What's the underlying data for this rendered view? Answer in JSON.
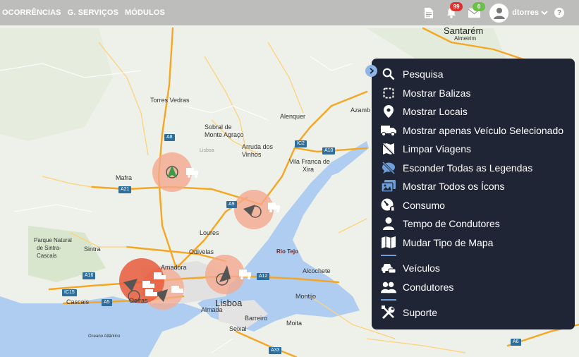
{
  "nav": {
    "items": [
      "OCORRÊNCIAS",
      "G. SERVIÇOS",
      "MÓDULOS"
    ]
  },
  "header": {
    "alerts_badge": "99",
    "messages_badge": "0",
    "username": "dtorres",
    "help_label": "?"
  },
  "menu": {
    "items": [
      {
        "label": "Pesquisa",
        "icon": "search-icon"
      },
      {
        "label": "Mostrar Balizas",
        "icon": "dashed-square-icon"
      },
      {
        "label": "Mostrar Locais",
        "icon": "map-pin-icon"
      },
      {
        "label": "Mostrar apenas Veículo Selecionado",
        "icon": "truck-icon"
      },
      {
        "label": "Limpar Viagens",
        "icon": "map-off-icon"
      },
      {
        "label": "Esconder Todas as Legendas",
        "icon": "comment-off-icon"
      },
      {
        "label": "Mostrar Todos os Ícons",
        "icon": "images-icon"
      },
      {
        "label": "Consumo",
        "icon": "gauge-fuel-icon"
      },
      {
        "label": "Tempo de Condutores",
        "icon": "user-icon"
      },
      {
        "label": "Mudar Tipo de Mapa",
        "icon": "map-icon"
      }
    ],
    "items2": [
      {
        "label": "Veículos",
        "icon": "car-icon"
      },
      {
        "label": "Condutores",
        "icon": "users-icon"
      }
    ],
    "items3": [
      {
        "label": "Suporte",
        "icon": "tools-icon"
      }
    ]
  },
  "map": {
    "places": {
      "santarem": "Santarém",
      "almeirim": "Almeirim",
      "torres_vedras": "Torres Vedras",
      "sobral": "Sobral de",
      "monte_agraco": "Monte Agraço",
      "arruda": "Arruda dos",
      "vinhos": "Vinhos",
      "alenquer": "Alenquer",
      "azambuja": "Azamb",
      "vila_franca": "Vila Franca de",
      "xira": "Xira",
      "mafra": "Mafra",
      "loures": "Loures",
      "odivelas": "Odivelas",
      "amadora": "Amadora",
      "sintra": "Sintra",
      "parque1": "Parque Natural",
      "parque2": "de Sintra-",
      "parque3": "Cascais",
      "cascais": "Cascais",
      "oeiras": "Oeiras",
      "lisboa": "Lisboa",
      "almada": "Almada",
      "barreiro": "Barreiro",
      "seixal": "Seixal",
      "moita": "Moita",
      "montijo": "Montijo",
      "alcochete": "Alcochete",
      "rio_tejo": "Rio Tejo",
      "oceano": "Oceano Atlântico",
      "lisboa_district": "Lisboa"
    },
    "roads": {
      "a8": "A8",
      "a21": "A21",
      "ic2": "IC2",
      "a10": "A10",
      "a9": "A9",
      "a16": "A16",
      "ic15": "IC15",
      "a5": "A5",
      "a12": "A12",
      "a33": "A33",
      "a6": "A6"
    }
  },
  "colors": {
    "topbar": "#969696",
    "panel": "#1f2535",
    "accent": "#8fb4e6",
    "cluster": "#f08a6a",
    "road": "#f5a623"
  }
}
